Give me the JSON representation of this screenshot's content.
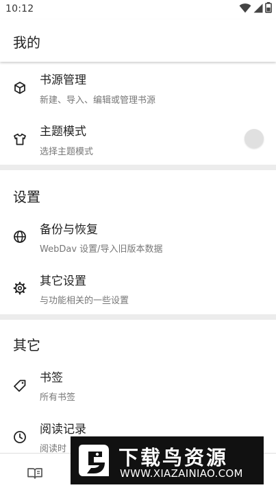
{
  "status_bar": {
    "time": "10:12",
    "icons": [
      "wifi-icon",
      "signal-icon",
      "battery-icon"
    ]
  },
  "header": {
    "title": "我的"
  },
  "general": {
    "items": [
      {
        "icon": "cube-icon",
        "title": "书源管理",
        "subtitle": "新建、导入、编辑或管理书源"
      },
      {
        "icon": "tshirt-icon",
        "title": "主题模式",
        "subtitle": "选择主题模式",
        "toggle_on": false
      }
    ]
  },
  "settings": {
    "title": "设置",
    "items": [
      {
        "icon": "globe-icon",
        "title": "备份与恢复",
        "subtitle": "WebDav 设置/导入旧版本数据"
      },
      {
        "icon": "gear-icon",
        "title": "其它设置",
        "subtitle": "与功能相关的一些设置"
      }
    ]
  },
  "other": {
    "title": "其它",
    "items": [
      {
        "icon": "tag-icon",
        "title": "书签",
        "subtitle": "所有书签"
      },
      {
        "icon": "clock-icon",
        "title": "阅读记录",
        "subtitle": "阅读时"
      }
    ]
  },
  "bottom_nav": {
    "items": [
      "book-open-icon"
    ]
  },
  "watermark": {
    "title": "下载鸟资源",
    "url": "WWW.XIAZAINIAO.COM"
  },
  "colors": {
    "background": "#ececec",
    "surface": "#ffffff",
    "text_primary": "#222222",
    "text_secondary": "#777777",
    "toggle_knob": "#e0e0e0"
  }
}
